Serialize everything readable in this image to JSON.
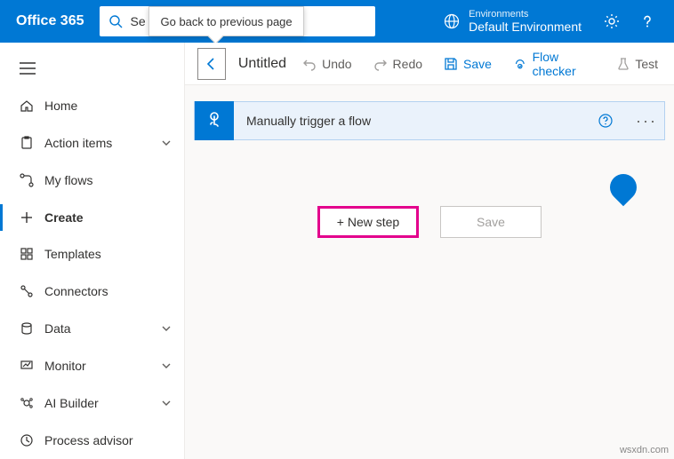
{
  "header": {
    "brand": "Office 365",
    "search_partial": "Se",
    "tooltip": "Go back to previous page",
    "env_label": "Environments",
    "env_name": "Default Environment"
  },
  "sidebar": {
    "items": [
      {
        "label": "Home"
      },
      {
        "label": "Action items"
      },
      {
        "label": "My flows"
      },
      {
        "label": "Create"
      },
      {
        "label": "Templates"
      },
      {
        "label": "Connectors"
      },
      {
        "label": "Data"
      },
      {
        "label": "Monitor"
      },
      {
        "label": "AI Builder"
      },
      {
        "label": "Process advisor"
      }
    ]
  },
  "cmd": {
    "title": "Untitled",
    "undo": "Undo",
    "redo": "Redo",
    "save": "Save",
    "checker": "Flow checker",
    "test": "Test"
  },
  "trigger": {
    "text": "Manually trigger a flow"
  },
  "actions": {
    "new_step": "+ New step",
    "save": "Save"
  },
  "watermark": "wsxdn.com"
}
